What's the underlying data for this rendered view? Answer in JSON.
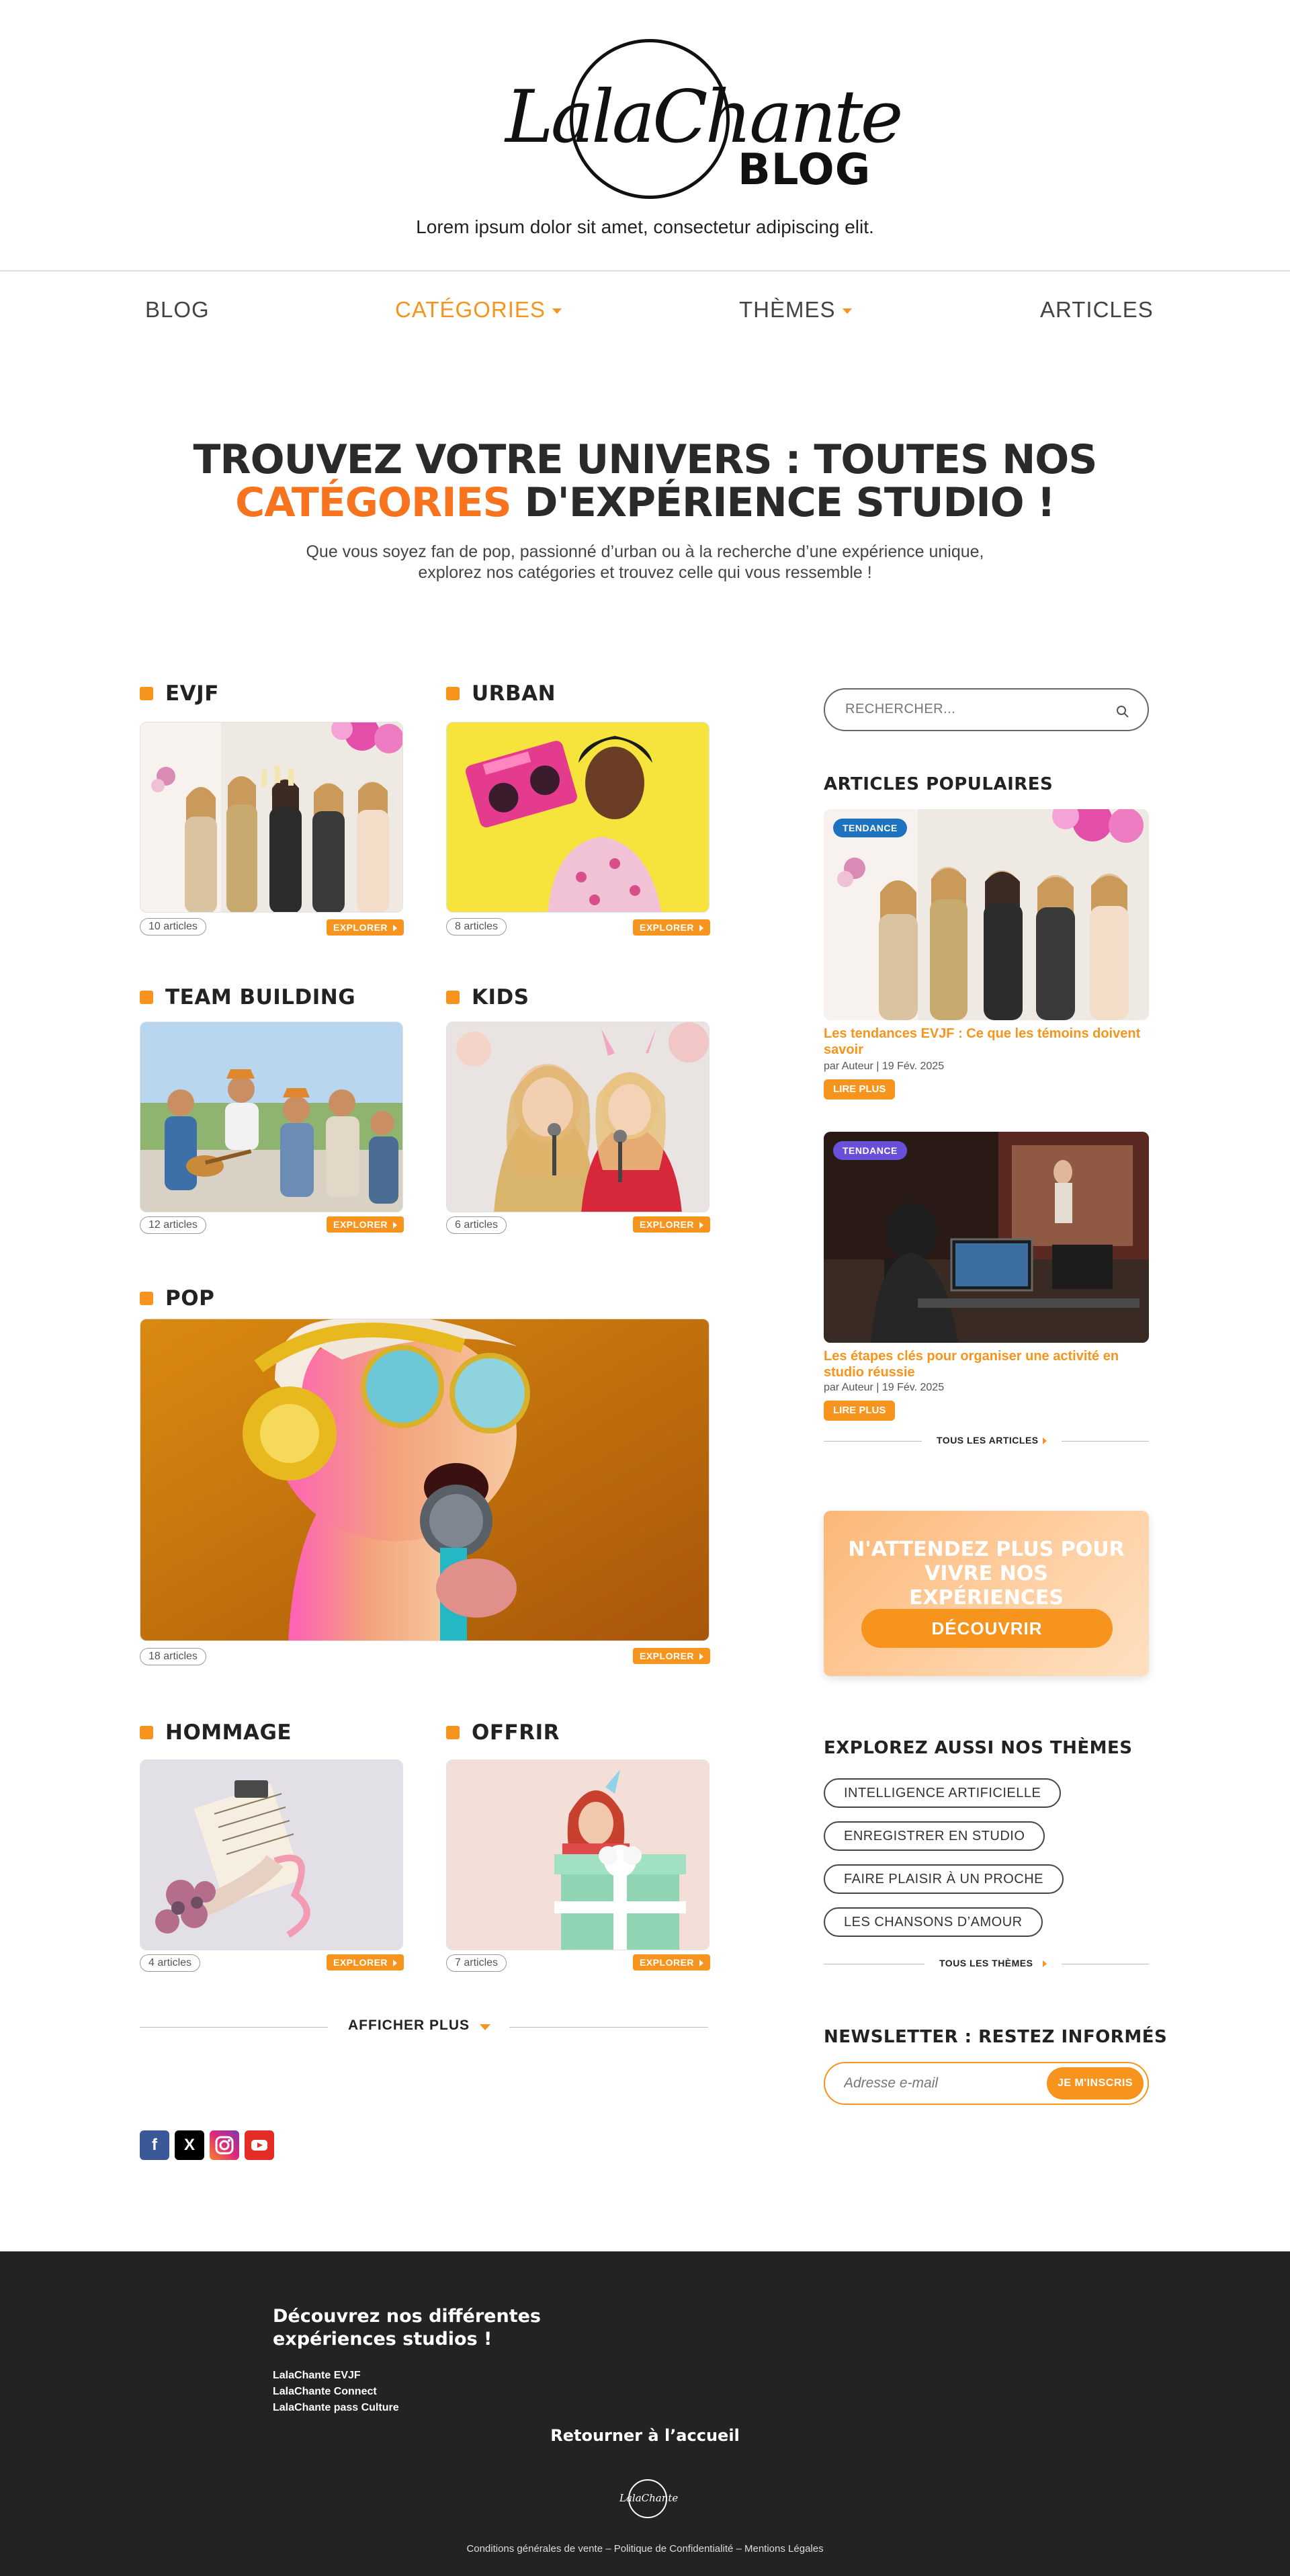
{
  "header": {
    "logo_script": "LalaChante",
    "logo_blog": "BLOG",
    "tagline": "Lorem ipsum dolor sit amet, consectetur adipiscing elit."
  },
  "nav": {
    "items": [
      {
        "label": "BLOG"
      },
      {
        "label": "CATÉGORIES"
      },
      {
        "label": "THÈMES"
      },
      {
        "label": "ARTICLES"
      }
    ],
    "accent": "#f7941d"
  },
  "hero": {
    "title_line1": "TROUVEZ VOTRE UNIVERS : TOUTES NOS",
    "title_accent": "CATÉGORIES",
    "title_line2_rest": " D'EXPÉRIENCE STUDIO !",
    "subtitle_line1": "Que vous soyez fan de pop, passionné d’urban ou à la recherche d’une expérience unique,",
    "subtitle_line2": "explorez nos catégories et trouvez celle qui vous ressemble !"
  },
  "categories": [
    {
      "name": "EVJF",
      "count": "10 articles",
      "button": "EXPLORER"
    },
    {
      "name": "URBAN",
      "count": "8 articles",
      "button": "EXPLORER"
    },
    {
      "name": "TEAM BUILDING",
      "count": "12 articles",
      "button": "EXPLORER"
    },
    {
      "name": "KIDS",
      "count": "6 articles",
      "button": "EXPLORER"
    },
    {
      "name": "POP",
      "count": "18 articles",
      "button": "EXPLORER"
    },
    {
      "name": "HOMMAGE",
      "count": "4 articles",
      "button": "EXPLORER"
    },
    {
      "name": "OFFRIR",
      "count": "7 articles",
      "button": "EXPLORER"
    }
  ],
  "show_more": {
    "label": "AFFICHER PLUS"
  },
  "socials": [
    {
      "icon": "facebook-icon",
      "color": "#3b5998"
    },
    {
      "icon": "x-icon",
      "color": "#000000"
    },
    {
      "icon": "instagram-icon",
      "color": "#c13584"
    },
    {
      "icon": "youtube-icon",
      "color": "#e52d27"
    }
  ],
  "sidebar": {
    "search_placeholder": "RECHERCHER...",
    "popular_title": "ARTICLES POPULAIRES",
    "articles": [
      {
        "badge": "TENDANCE",
        "badge_color": "#1e73be",
        "title": "Les tendances EVJF : Ce que les témoins doivent savoir",
        "meta": "par Auteur | 19 Fév. 2025",
        "button": "LIRE PLUS"
      },
      {
        "badge": "TENDANCE",
        "badge_color": "#6a4fd8",
        "title": "Les étapes clés pour organiser une activité en studio réussie",
        "meta": "par Auteur | 19 Fév. 2025",
        "button": "LIRE PLUS"
      }
    ],
    "all_articles": "TOUS LES ARTICLES",
    "cta_text": "N'ATTENDEZ PLUS POUR VIVRE NOS EXPÉRIENCES",
    "cta_button": "DÉCOUVRIR",
    "themes_title": "EXPLOREZ AUSSI NOS THÈMES",
    "themes": [
      "INTELLIGENCE ARTIFICIELLE",
      "ENREGISTRER EN STUDIO",
      "FAIRE PLAISIR À UN PROCHE",
      "LES CHANSONS D’AMOUR"
    ],
    "all_themes": "TOUS LES THÈMES",
    "newsletter_title": "NEWSLETTER : RESTEZ INFORMÉS",
    "newsletter_placeholder": "Adresse e-mail",
    "newsletter_button": "JE M'INSCRIS"
  },
  "footer": {
    "title": "Découvrez nos différentes expériences studios !",
    "links": [
      "LalaChante EVJF",
      "LalaChante Connect",
      "LalaChante pass Culture"
    ],
    "home": "Retourner à l’accueil",
    "logo_text": "LalaChante",
    "legal": "Conditions générales de vente – Politique de Confidentialité – Mentions Légales"
  }
}
